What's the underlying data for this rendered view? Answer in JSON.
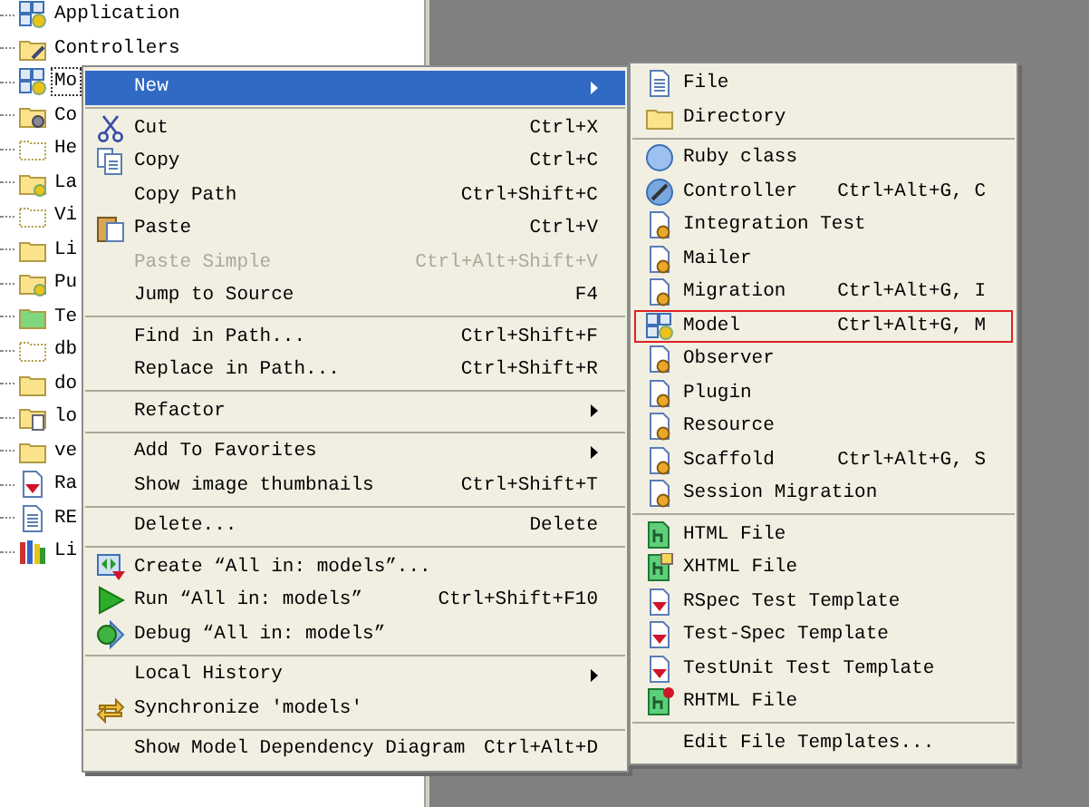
{
  "tree": {
    "items": [
      {
        "label": "Application",
        "focused": false
      },
      {
        "label": "Controllers",
        "focused": false
      },
      {
        "label": "Mo",
        "focused": true
      },
      {
        "label": "Co",
        "focused": false
      },
      {
        "label": "He",
        "focused": false
      },
      {
        "label": "La",
        "focused": false
      },
      {
        "label": "Vi",
        "focused": false
      },
      {
        "label": "Li",
        "focused": false
      },
      {
        "label": "Pu",
        "focused": false
      },
      {
        "label": "Te",
        "focused": false
      },
      {
        "label": "db",
        "focused": false
      },
      {
        "label": "do",
        "focused": false
      },
      {
        "label": "lo",
        "focused": false
      },
      {
        "label": "ve",
        "focused": false
      },
      {
        "label": "Ra",
        "focused": false
      },
      {
        "label": "RE",
        "focused": false
      },
      {
        "label": "Li",
        "focused": false
      }
    ]
  },
  "context_menu": {
    "items": [
      {
        "kind": "item",
        "label": "New",
        "selected": true,
        "disabled": false,
        "has_submenu": true
      },
      {
        "kind": "separator"
      },
      {
        "kind": "item",
        "label": "Cut",
        "shortcut": "Ctrl+X",
        "selected": false,
        "disabled": false,
        "has_submenu": false
      },
      {
        "kind": "item",
        "label": "Copy",
        "shortcut": "Ctrl+C",
        "selected": false,
        "disabled": false,
        "has_submenu": false
      },
      {
        "kind": "item",
        "label": "Copy Path",
        "shortcut": "Ctrl+Shift+C",
        "selected": false,
        "disabled": false,
        "has_submenu": false
      },
      {
        "kind": "item",
        "label": "Paste",
        "shortcut": "Ctrl+V",
        "selected": false,
        "disabled": false,
        "has_submenu": false
      },
      {
        "kind": "item",
        "label": "Paste Simple",
        "shortcut": "Ctrl+Alt+Shift+V",
        "selected": false,
        "disabled": true,
        "has_submenu": false
      },
      {
        "kind": "item",
        "label": "Jump to Source",
        "shortcut": "F4",
        "selected": false,
        "disabled": false,
        "has_submenu": false
      },
      {
        "kind": "separator"
      },
      {
        "kind": "item",
        "label": "Find in Path...",
        "shortcut": "Ctrl+Shift+F",
        "selected": false,
        "disabled": false,
        "has_submenu": false
      },
      {
        "kind": "item",
        "label": "Replace in Path...",
        "shortcut": "Ctrl+Shift+R",
        "selected": false,
        "disabled": false,
        "has_submenu": false
      },
      {
        "kind": "separator"
      },
      {
        "kind": "item",
        "label": "Refactor",
        "selected": false,
        "disabled": false,
        "has_submenu": true
      },
      {
        "kind": "separator"
      },
      {
        "kind": "item",
        "label": "Add To Favorites",
        "selected": false,
        "disabled": false,
        "has_submenu": true
      },
      {
        "kind": "item",
        "label": "Show image thumbnails",
        "shortcut": "Ctrl+Shift+T",
        "selected": false,
        "disabled": false,
        "has_submenu": false
      },
      {
        "kind": "separator"
      },
      {
        "kind": "item",
        "label": "Delete...",
        "shortcut": "Delete",
        "selected": false,
        "disabled": false,
        "has_submenu": false
      },
      {
        "kind": "separator"
      },
      {
        "kind": "item",
        "label": "Create “All in: models”...",
        "selected": false,
        "disabled": false,
        "has_submenu": false
      },
      {
        "kind": "item",
        "label": "Run “All in: models”",
        "shortcut": "Ctrl+Shift+F10",
        "selected": false,
        "disabled": false,
        "has_submenu": false
      },
      {
        "kind": "item",
        "label": "Debug “All in: models”",
        "selected": false,
        "disabled": false,
        "has_submenu": false
      },
      {
        "kind": "separator"
      },
      {
        "kind": "item",
        "label": "Local History",
        "selected": false,
        "disabled": false,
        "has_submenu": true
      },
      {
        "kind": "item",
        "label": "Synchronize 'models'",
        "selected": false,
        "disabled": false,
        "has_submenu": false
      },
      {
        "kind": "separator"
      },
      {
        "kind": "item",
        "label": "Show Model Dependency Diagram",
        "shortcut": "Ctrl+Alt+D",
        "selected": false,
        "disabled": false,
        "has_submenu": false
      }
    ]
  },
  "submenu": {
    "items": [
      {
        "kind": "item",
        "label": "File",
        "outlined": false
      },
      {
        "kind": "item",
        "label": "Directory",
        "outlined": false
      },
      {
        "kind": "separator"
      },
      {
        "kind": "item",
        "label": "Ruby class",
        "outlined": false
      },
      {
        "kind": "item",
        "label": "Controller",
        "shortcut": "Ctrl+Alt+G, C",
        "outlined": false
      },
      {
        "kind": "item",
        "label": "Integration Test",
        "outlined": false
      },
      {
        "kind": "item",
        "label": "Mailer",
        "outlined": false
      },
      {
        "kind": "item",
        "label": "Migration",
        "shortcut": "Ctrl+Alt+G, I",
        "outlined": false
      },
      {
        "kind": "item",
        "label": "Model",
        "shortcut": "Ctrl+Alt+G, M",
        "outlined": true
      },
      {
        "kind": "item",
        "label": "Observer",
        "outlined": false
      },
      {
        "kind": "item",
        "label": "Plugin",
        "outlined": false
      },
      {
        "kind": "item",
        "label": "Resource",
        "outlined": false
      },
      {
        "kind": "item",
        "label": "Scaffold",
        "shortcut": "Ctrl+Alt+G, S",
        "outlined": false
      },
      {
        "kind": "item",
        "label": "Session Migration",
        "outlined": false
      },
      {
        "kind": "separator"
      },
      {
        "kind": "item",
        "label": "HTML File",
        "outlined": false
      },
      {
        "kind": "item",
        "label": "XHTML File",
        "outlined": false
      },
      {
        "kind": "item",
        "label": "RSpec Test Template",
        "outlined": false
      },
      {
        "kind": "item",
        "label": "Test-Spec Template",
        "outlined": false
      },
      {
        "kind": "item",
        "label": "TestUnit Test Template",
        "outlined": false
      },
      {
        "kind": "item",
        "label": "RHTML File",
        "outlined": false
      },
      {
        "kind": "separator"
      },
      {
        "kind": "item",
        "label": "Edit File Templates...",
        "outlined": false
      }
    ]
  }
}
